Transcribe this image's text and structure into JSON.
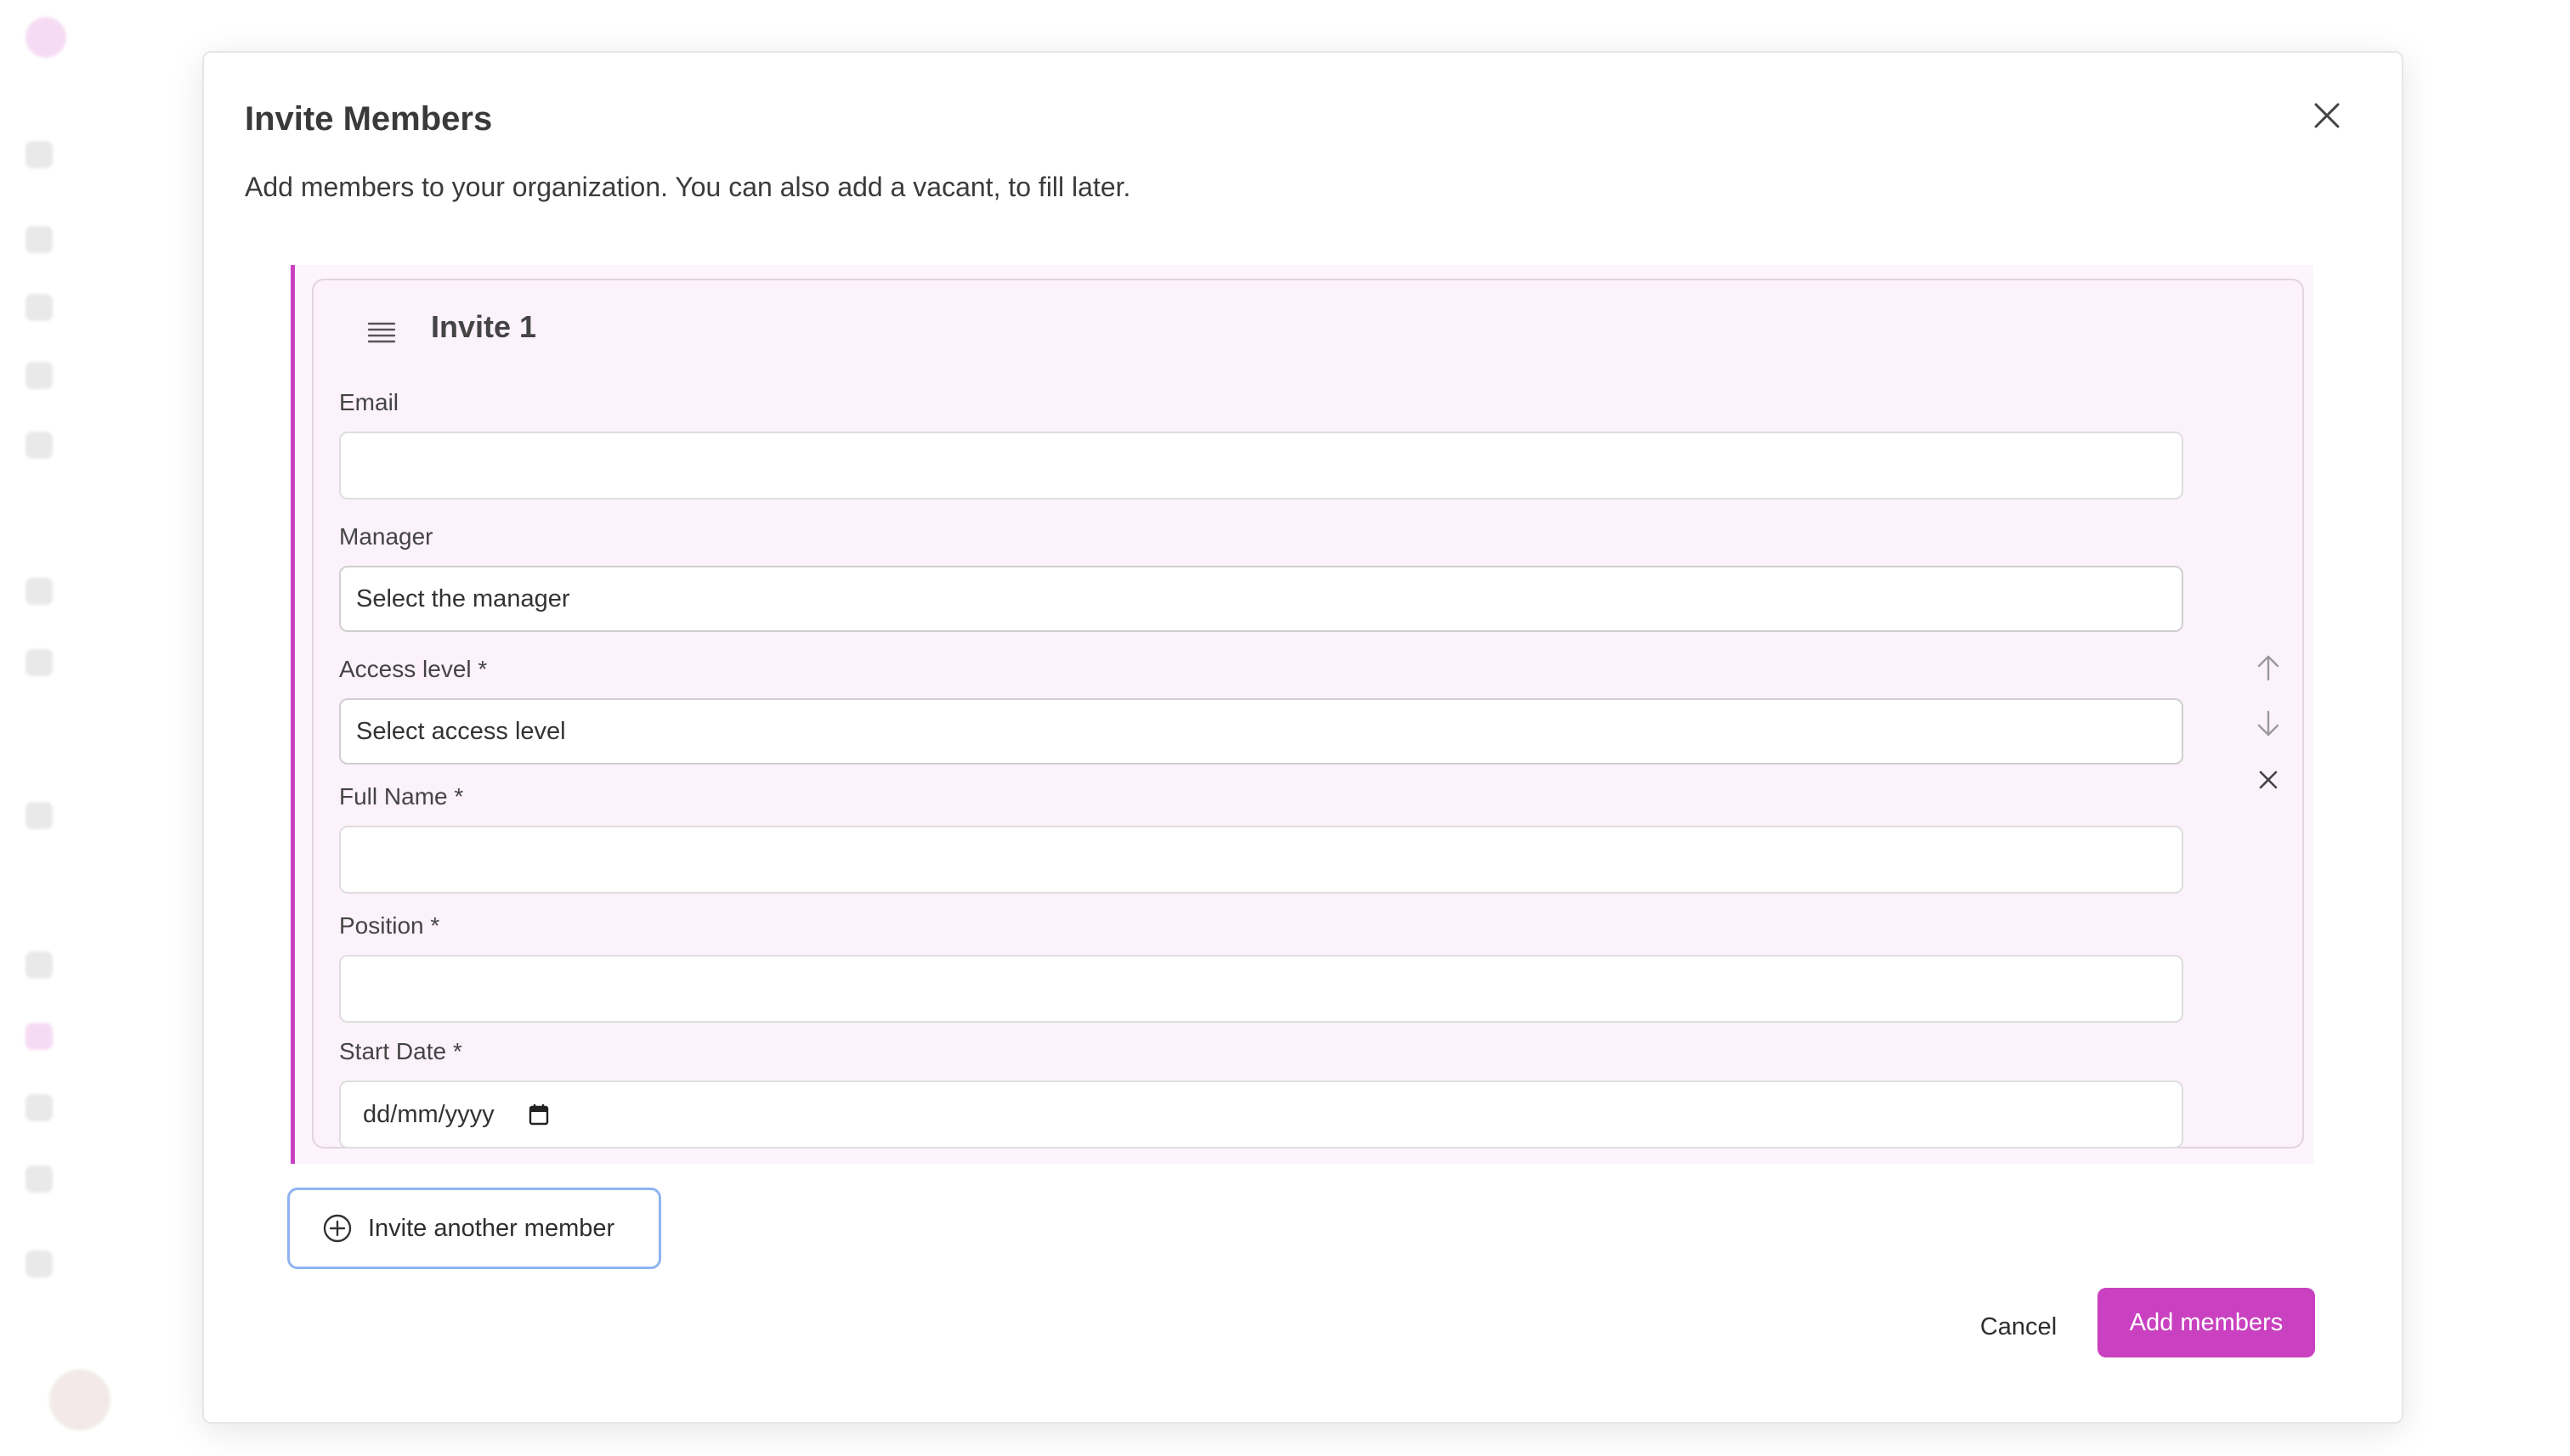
{
  "modal": {
    "title": "Invite Members",
    "description": "Add members to your organization. You can also add a vacant, to fill later.",
    "close_icon": "close-icon"
  },
  "invite": {
    "title": "Invite 1",
    "fields": {
      "email": {
        "label": "Email",
        "value": ""
      },
      "manager": {
        "label": "Manager",
        "placeholder": "Select the manager"
      },
      "access_level": {
        "label": "Access level *",
        "placeholder": "Select access level"
      },
      "full_name": {
        "label": "Full Name *",
        "value": ""
      },
      "position": {
        "label": "Position *",
        "value": ""
      },
      "start_date": {
        "label": "Start Date *",
        "placeholder": "dd/mm/yyyy"
      }
    },
    "actions": {
      "move_up_icon": "arrow-up-icon",
      "move_down_icon": "arrow-down-icon",
      "remove_icon": "close-icon"
    }
  },
  "buttons": {
    "invite_another": "Invite another member",
    "cancel": "Cancel",
    "add_members": "Add members"
  },
  "colors": {
    "accent": "#c940c0",
    "card_bg": "#fcf2fb",
    "focus_border": "#8fb3f2"
  }
}
